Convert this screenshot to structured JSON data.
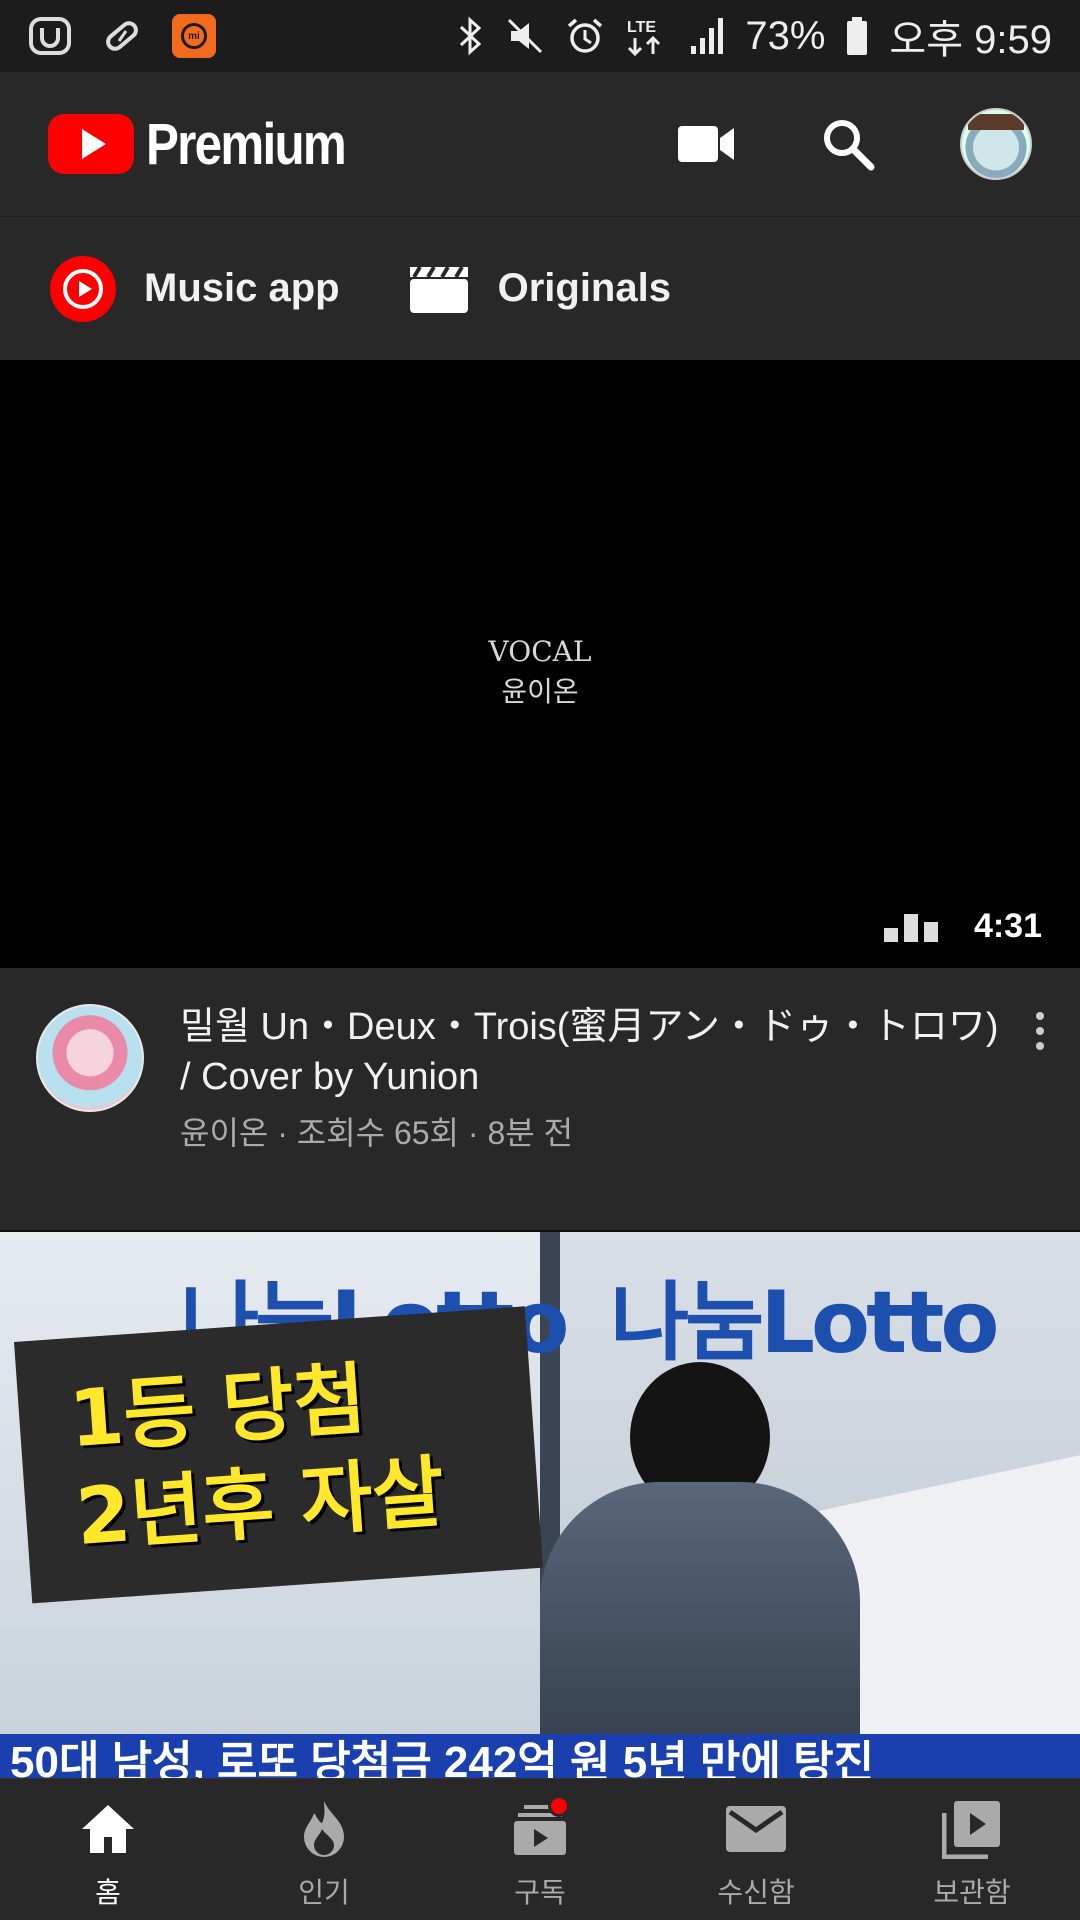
{
  "status_bar": {
    "battery": "73%",
    "time": "오후 9:59",
    "network": "LTE",
    "icons": [
      "u-plus-icon",
      "pill-icon",
      "mi-icon",
      "bluetooth-icon",
      "mute-icon",
      "alarm-icon",
      "signal-icon",
      "battery-icon"
    ]
  },
  "header": {
    "brand": "Premium",
    "actions": [
      "video-camera-icon",
      "search-icon",
      "account-avatar"
    ]
  },
  "chips": [
    {
      "label": "Music app",
      "icon": "youtube-music-icon"
    },
    {
      "label": "Originals",
      "icon": "clapperboard-icon"
    }
  ],
  "video1": {
    "overlay_line1": "VOCAL",
    "overlay_line2": "윤이온",
    "duration": "4:31",
    "title": "밀월 Un・Deux・Trois(蜜月アン・ドゥ・トロワ) / Cover by Yunion",
    "subtitle": "윤이온 · 조회수 65회 · 8분 전"
  },
  "video2": {
    "lotto_left": "나눔Lotto",
    "lotto_right": "나눔Lotto",
    "banner_line1": "1등 당첨",
    "banner_line2": "2년후 자살",
    "ticker": "50대 남성, 로또 당첨금 242억 원 5년 만에 탕진"
  },
  "bottom_nav": [
    {
      "label": "홈",
      "icon": "home-icon",
      "active": true
    },
    {
      "label": "인기",
      "icon": "trending-flame-icon",
      "active": false
    },
    {
      "label": "구독",
      "icon": "subscriptions-icon",
      "active": false,
      "badge": true
    },
    {
      "label": "수신함",
      "icon": "inbox-mail-icon",
      "active": false
    },
    {
      "label": "보관함",
      "icon": "library-icon",
      "active": false
    }
  ],
  "colors": {
    "brand_red": "#ff0000",
    "background": "#282828",
    "statusbar": "#1c1c1c",
    "banner_yellow": "#ffe82b",
    "lotto_blue": "#1d4fae"
  }
}
